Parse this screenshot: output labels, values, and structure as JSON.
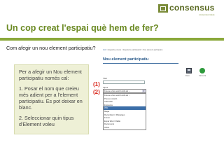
{
  "header": {
    "logo_text": "consensus",
    "logo_subtext": "consensus ideas",
    "title": "Un cop creat l'espai què hem de fer?",
    "subtitle": "Com afegir un nou element participatiu?"
  },
  "colors": {
    "accent_green": "#6b8a23",
    "bar_green": "#8aa83a",
    "marker_red": "#d9281d",
    "info_bg": "#eef0d6"
  },
  "info_box": {
    "paragraphs": [
      "Per a afegir un Nou element participatiu només cal:",
      "1. Posar el nom que creieu més adient per a l'element participatiu. Es pot deixar en blanc.",
      "2. Seleccionar quin tipus d'Element voleu"
    ]
  },
  "markers": [
    "(1)",
    "(2)"
  ],
  "screenshot": {
    "breadcrumb_link": "Inici",
    "breadcrumb_rest": " > Espai de proves > Espais de participació > Nou element participatiu",
    "form_title": "Nou element participatiu",
    "title_label": "Títol",
    "type_label": "Tipus",
    "type_selected": "Fes-se el teu escrit amb els ...",
    "options": [
      "Fes-se el teu escrit amb els ...",
      "Posa a votació",
      "Calendari",
      "Enquesta",
      "Wiki",
      "Mapa",
      "Recordatori / Missatges",
      "Fòrum",
      "Espai Web / Ràdio",
      "Documents",
      "Altres"
    ],
    "selected_option_index": 4,
    "save_label": "Desa",
    "cancel_label": "Cancel·la",
    "icons": [
      "save-icon",
      "cancel-icon"
    ]
  }
}
